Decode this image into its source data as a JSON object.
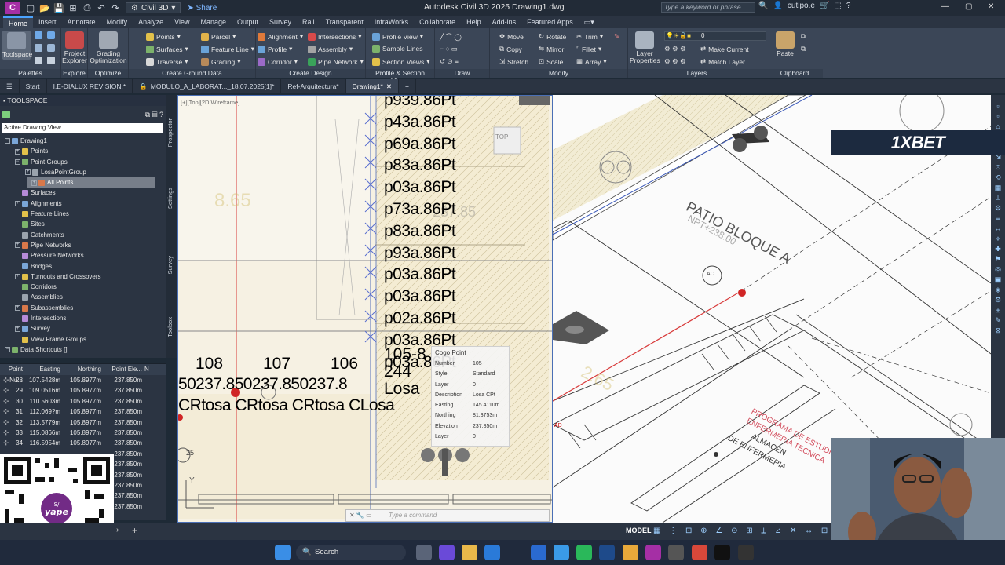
{
  "app": {
    "logo_letter": "C",
    "workspace": "Civil 3D",
    "share": "Share",
    "title": "Autodesk Civil 3D 2025    Drawing1.dwg",
    "search_placeholder": "Type a keyword or phrase",
    "user": "cutipo.e"
  },
  "ribbon_tabs": [
    "Home",
    "Insert",
    "Annotate",
    "Modify",
    "Analyze",
    "View",
    "Manage",
    "Output",
    "Survey",
    "Rail",
    "Transparent",
    "InfraWorks",
    "Collaborate",
    "Help",
    "Add-ins",
    "Featured Apps"
  ],
  "ribbon": {
    "palettes": {
      "title": "Palettes",
      "toolspace": "Toolspace"
    },
    "explore": {
      "title": "Explore",
      "project_explorer": "Project\nExplorer"
    },
    "optimize": {
      "title": "Optimize",
      "grading_optimization": "Grading\nOptimization"
    },
    "create_ground": {
      "title": "Create Ground Data",
      "items": [
        "Points",
        "Surfaces",
        "Traverse"
      ],
      "items2": [
        "Parcel",
        "Feature Line",
        "Grading"
      ]
    },
    "create_design": {
      "title": "Create Design",
      "items": [
        "Alignment",
        "Profile",
        "Corridor"
      ],
      "items2": [
        "Intersections",
        "Assembly",
        "Pipe Network"
      ]
    },
    "profile_section": {
      "title": "Profile & Section Views",
      "items": [
        "Profile View",
        "Sample Lines",
        "Section Views"
      ]
    },
    "draw": {
      "title": "Draw"
    },
    "modify": {
      "title": "Modify",
      "items": [
        "Move",
        "Copy",
        "Stretch"
      ],
      "items2": [
        "Rotate",
        "Mirror",
        "Scale"
      ],
      "items3": [
        "Trim",
        "Fillet",
        "Array"
      ]
    },
    "layers": {
      "title": "Layers",
      "layer_props": "Layer\nProperties",
      "layer_value": "0",
      "make_current": "Make Current",
      "match_layer": "Match Layer"
    },
    "clipboard": {
      "title": "Clipboard",
      "paste": "Paste"
    }
  },
  "doc_tabs": [
    "Start",
    "I.E-DIALUX REVISION.*",
    "MODULO_A_LABORAT..._18.07.2025[1]*",
    "Ref-Arquitectura*",
    "Drawing1*"
  ],
  "toolspace": {
    "header": "TOOLSPACE",
    "view": "Active Drawing View",
    "tree": [
      {
        "label": "Drawing1",
        "level": 0,
        "pm": "-"
      },
      {
        "label": "Points",
        "level": 1,
        "pm": "+"
      },
      {
        "label": "Point Groups",
        "level": 1,
        "pm": "-"
      },
      {
        "label": "LosaPointGroup",
        "level": 2,
        "pm": "+"
      },
      {
        "label": "All Points",
        "level": 2,
        "pm": "+",
        "selected": true
      },
      {
        "label": "Surfaces",
        "level": 1,
        "pm": ""
      },
      {
        "label": "Alignments",
        "level": 1,
        "pm": "+"
      },
      {
        "label": "Feature Lines",
        "level": 1,
        "pm": ""
      },
      {
        "label": "Sites",
        "level": 1,
        "pm": ""
      },
      {
        "label": "Catchments",
        "level": 1,
        "pm": ""
      },
      {
        "label": "Pipe Networks",
        "level": 1,
        "pm": "+"
      },
      {
        "label": "Pressure Networks",
        "level": 1,
        "pm": ""
      },
      {
        "label": "Bridges",
        "level": 1,
        "pm": ""
      },
      {
        "label": "Turnouts and Crossovers",
        "level": 1,
        "pm": "+"
      },
      {
        "label": "Corridors",
        "level": 1,
        "pm": ""
      },
      {
        "label": "Assemblies",
        "level": 1,
        "pm": ""
      },
      {
        "label": "Subassemblies",
        "level": 1,
        "pm": "+"
      },
      {
        "label": "Intersections",
        "level": 1,
        "pm": ""
      },
      {
        "label": "Survey",
        "level": 1,
        "pm": "+"
      },
      {
        "label": "View Frame Groups",
        "level": 1,
        "pm": ""
      },
      {
        "label": "Data Shortcuts []",
        "level": 0,
        "pm": "-"
      }
    ],
    "vtabs": [
      "Prospector",
      "Settings",
      "Survey",
      "Toolbox"
    ]
  },
  "point_table": {
    "headers": [
      "Point Nu...",
      "Easting",
      "Northing",
      "Point Ele...",
      "N"
    ],
    "rows": [
      [
        "28",
        "107.5428m",
        "105.8977m",
        "237.850m"
      ],
      [
        "29",
        "109.0516m",
        "105.8977m",
        "237.850m"
      ],
      [
        "30",
        "110.5603m",
        "105.8977m",
        "237.850m"
      ],
      [
        "31",
        "112.069?m",
        "105.8977m",
        "237.850m"
      ],
      [
        "32",
        "113.5779m",
        "105.8977m",
        "237.850m"
      ],
      [
        "33",
        "115.0866m",
        "105.8977m",
        "237.850m"
      ],
      [
        "34",
        "116.5954m",
        "105.8977m",
        "237.850m"
      ],
      [
        "",
        "",
        "",
        "237.850m"
      ],
      [
        "",
        "",
        "",
        "237.850m"
      ],
      [
        "",
        "",
        "",
        "237.850m"
      ],
      [
        "",
        "",
        "",
        "237.850m"
      ],
      [
        "",
        "",
        "",
        "237.850m"
      ],
      [
        "",
        "",
        "",
        "237.850m"
      ]
    ]
  },
  "viewport": {
    "label": "[+][Top][2D Wireframe]",
    "numbers": [
      "108",
      "107",
      "106"
    ],
    "elevations": "50237.850237.850237.8",
    "losa_row": "CRtosa CRtosa CRtosa CLosa",
    "stack": [
      "p939.86Pt",
      "p43a.86Pt",
      "p69a.86Pt",
      "p83a.86Pt",
      "p03a.86Pt",
      "p73a.86Pt",
      "p83a.86Pt",
      "p93a.86Pt",
      "p03a.86Pt",
      "p03a.86Pt",
      "p02a.86Pt",
      "p03a.86Pt",
      "p03a.86Pt"
    ],
    "stack_tail": [
      "105-8",
      "244",
      "Losa"
    ],
    "faded_865": "8.65",
    "faded_237": "237.85",
    "viewcube": "TOP",
    "tooltip": {
      "title": "Cogo Point",
      "rows": [
        [
          "Number",
          "105"
        ],
        [
          "Style",
          "Standard"
        ],
        [
          "Layer",
          "0"
        ],
        [
          "Description",
          "Losa CPt"
        ],
        [
          "Easting",
          "145.4110m"
        ],
        [
          "Northing",
          "81.3753m"
        ],
        [
          "Elevation",
          "237.850m"
        ],
        [
          "Layer",
          "0"
        ]
      ]
    },
    "command_placeholder": "Type a command",
    "ucs_y": "Y",
    "circle_num": "25"
  },
  "viewport2": {
    "patio": "PATIO BLOQUE A",
    "npt": "NPT+238.00",
    "ac": "AC",
    "programa": "PROGRAMA DE ESTUDIO",
    "enfermeria": "ENFERMERIA TECNICA",
    "almacen": "ALMACEN",
    "de_enf": "DE ENFERMERIA",
    "faded_265": "2.65",
    "ad": "AD"
  },
  "ad_banner": "1XBET",
  "status": {
    "model": "MODEL"
  },
  "taskbar": {
    "search": "Search"
  }
}
